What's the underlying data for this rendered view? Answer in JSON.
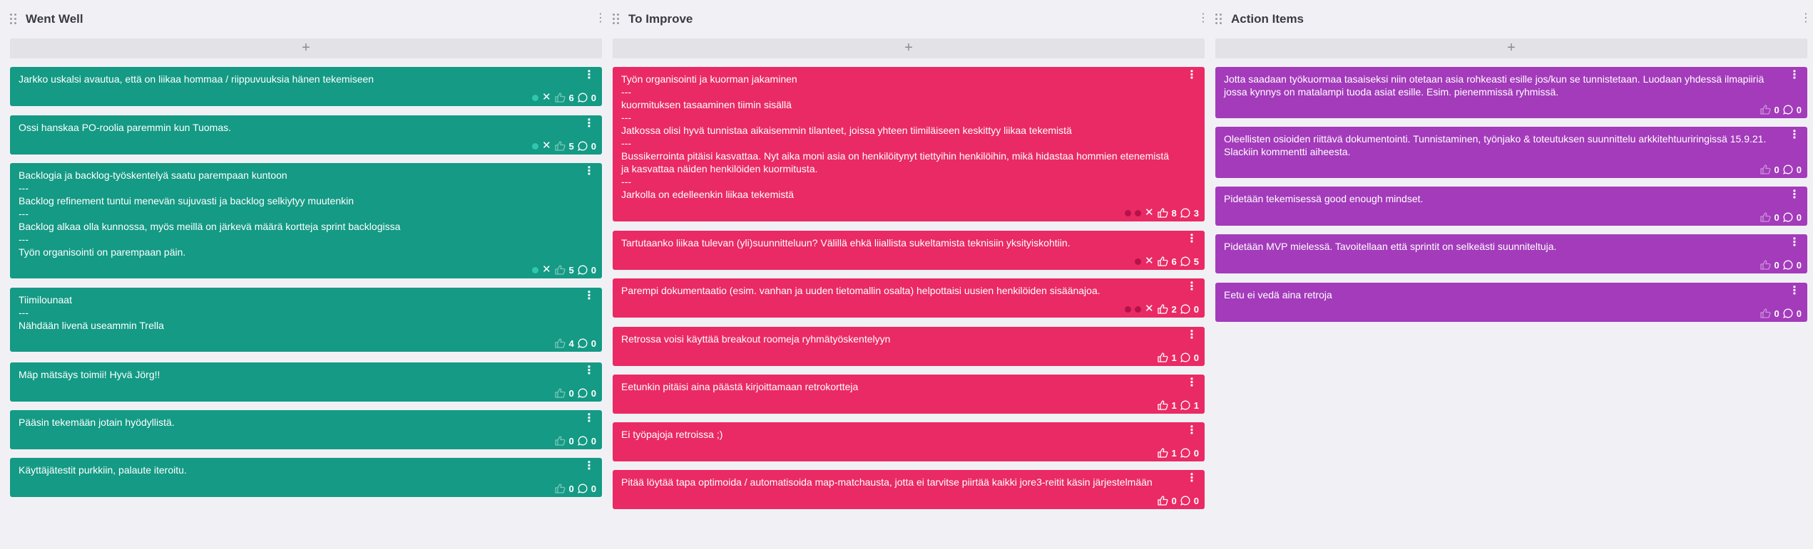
{
  "columns": [
    {
      "title": "Went Well",
      "add_label": "+",
      "cards": [
        {
          "text": "Jarkko uskalsi avautua, että on liikaa hommaa / riippuvuuksia hänen tekemiseen",
          "likes": "6",
          "comments": "0"
        },
        {
          "text": "Ossi hanskaa PO-roolia paremmin kun Tuomas.",
          "likes": "5",
          "comments": "0"
        },
        {
          "text": "Backlogia ja backlog-työskentelyä saatu parempaan kuntoon\n---\nBacklog refinement tuntui menevän sujuvasti ja backlog selkiytyy muutenkin\n---\nBacklog alkaa olla kunnossa, myös meillä on järkevä määrä kortteja sprint backlogissa\n---\nTyön organisointi on parempaan päin.",
          "likes": "5",
          "comments": "0"
        },
        {
          "text": "Tiimilounaat\n---\nNähdään livenä useammin Trella",
          "likes": "4",
          "comments": "0"
        },
        {
          "text": "Mäp mätsäys toimii! Hyvä Jörg!!",
          "likes": "0",
          "comments": "0"
        },
        {
          "text": "Pääsin tekemään jotain hyödyllistä.",
          "likes": "0",
          "comments": "0"
        },
        {
          "text": "Käyttäjätestit purkkiin, palaute iteroitu.",
          "likes": "0",
          "comments": "0"
        }
      ]
    },
    {
      "title": "To Improve",
      "add_label": "+",
      "cards": [
        {
          "text": "Työn organisointi ja kuorman jakaminen\n---\nkuormituksen tasaaminen tiimin sisällä\n---\nJatkossa olisi hyvä tunnistaa aikaisemmin tilanteet, joissa yhteen tiimiläiseen keskittyy liikaa tekemistä\n---\nBussikerrointa pitäisi kasvattaa. Nyt aika moni asia on henkilöitynyt tiettyihin henkilöihin, mikä hidastaa hommien etenemistä ja kasvattaa näiden henkilöiden kuormitusta.\n---\nJarkolla on edelleenkin liikaa tekemistä",
          "likes": "8",
          "comments": "3"
        },
        {
          "text": "Tartutaanko liikaa tulevan (yli)suunnitteluun? Välillä ehkä liiallista sukeltamista teknisiin yksityiskohtiin.",
          "likes": "6",
          "comments": "5"
        },
        {
          "text": "Parempi dokumentaatio (esim. vanhan ja uuden tietomallin osalta) helpottaisi uusien henkilöiden sisäänajoa.",
          "likes": "2",
          "comments": "0"
        },
        {
          "text": "Retrossa voisi käyttää breakout roomeja ryhmätyöskentelyyn",
          "likes": "1",
          "comments": "0"
        },
        {
          "text": "Eetunkin pitäisi aina päästä kirjoittamaan retrokortteja",
          "likes": "1",
          "comments": "1"
        },
        {
          "text": "Ei työpajoja retroissa ;)",
          "likes": "1",
          "comments": "0"
        },
        {
          "text": "Pitää löytää tapa optimoida / automatisoida map-matchausta, jotta ei tarvitse piirtää kaikki jore3-reitit käsin järjestelmään",
          "likes": "0",
          "comments": "0"
        }
      ]
    },
    {
      "title": "Action Items",
      "add_label": "+",
      "cards": [
        {
          "text": "Jotta saadaan työkuormaa tasaiseksi niin otetaan asia rohkeasti esille jos/kun se tunnistetaan. Luodaan yhdessä ilmapiiriä jossa kynnys on matalampi tuoda asiat esille. Esim. pienemmissä ryhmissä.",
          "likes": "0",
          "comments": "0"
        },
        {
          "text": "Oleellisten osioiden riittävä dokumentointi. Tunnistaminen, työnjako & toteutuksen suunnittelu arkkitehtuuriringissä 15.9.21. Slackiin kommentti aiheesta.",
          "likes": "0",
          "comments": "0"
        },
        {
          "text": "Pidetään tekemisessä good enough mindset.",
          "likes": "0",
          "comments": "0"
        },
        {
          "text": "Pidetään MVP mielessä. Tavoitellaan että sprintit on selkeästi suunniteltuja.",
          "likes": "0",
          "comments": "0"
        },
        {
          "text": "Eetu ei vedä aina retroja",
          "likes": "0",
          "comments": "0"
        }
      ]
    }
  ],
  "colors": {
    "went_well": "#149a85",
    "to_improve": "#ea2a64",
    "action_items": "#a33bbb",
    "background": "#f1f1f5"
  },
  "icons": {
    "column_handle": "drag-handle-icon",
    "menu": "kebab-menu-icon",
    "like": "thumbs-up-icon",
    "comment": "comment-icon",
    "dismiss": "close-icon",
    "vote": "vote-dot-icon"
  }
}
